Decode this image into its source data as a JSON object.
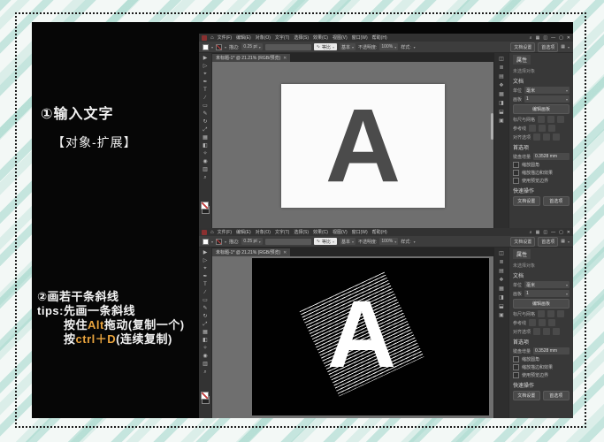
{
  "colors": {
    "stripe_teal": "#86cbbc",
    "poster_bg": "#060606",
    "highlight_orange": "#e8a33d",
    "letter_dark": "#4b4b4b",
    "letter_white": "#ffffff",
    "canvas_gray": "#6f6f6f"
  },
  "annotations": {
    "step1_title": "①输入文字",
    "step1_sub": "【对象-扩展】",
    "step2_title": "②画若干条斜线",
    "step2_tips": "tips:先画一条斜线",
    "step2_line3_pre": "按住",
    "step2_line3_key": "Alt",
    "step2_line3_post": "拖动(复制一个)",
    "step2_line4_pre": "按",
    "step2_line4_key": "ctrl＋D",
    "step2_line4_post": "(连续复制)"
  },
  "illustrator": {
    "menus": [
      "文件(F)",
      "编辑(E)",
      "对象(O)",
      "文字(T)",
      "选择(S)",
      "效果(C)",
      "视图(V)",
      "窗口(W)",
      "帮助(H)"
    ],
    "window_icons": {
      "search": "⌕",
      "arrange": "▦",
      "workspace": "◫",
      "minimize": "—",
      "maximize": "▢",
      "close": "✕"
    },
    "home_icon": "⌂",
    "doc_tab": "未标题-1* @ 21.21% (RGB/预览)",
    "tab_close": "✕",
    "controlbar": {
      "stroke_label": "描边:",
      "stroke_value": "0.25 pt",
      "profile_icon": "∿",
      "profile_value": "等比",
      "brush_value": "基本",
      "opacity_label": "不透明度:",
      "opacity_value": "100%",
      "style_label": "样式:",
      "doc_setup": "文档设置",
      "preferences": "首选项",
      "caret": "▾"
    },
    "tool_icons": [
      "▶",
      "▷",
      "⌖",
      "✒",
      "T",
      "∕",
      "▭",
      "✎",
      "↻",
      "⤢",
      "▦",
      "◧",
      "✧",
      "◉",
      "▥",
      "⌕"
    ],
    "panel_strip_icons": [
      "◫",
      "≣",
      "▤",
      "❖",
      "▦",
      "◨",
      "⬓",
      "▣"
    ],
    "properties": {
      "tab": "属性",
      "no_selection": "未选择对象",
      "document_label": "文档",
      "units_label": "单位",
      "units_value": "毫米",
      "artboard_label": "画板",
      "artboard_value": "1",
      "edit_artboards": "编辑画板",
      "rulers_label": "标尺与网格",
      "guides_label": "参考线",
      "snap_label": "对齐选项",
      "keyboard_label": "键盘增量",
      "keyboard_value": "0.3528 mm",
      "prefs_section": "首选项",
      "checkboxes": [
        "缩放圆角",
        "缩放描边和效果",
        "使用预览边界"
      ],
      "quick_label": "快速操作",
      "quick_buttons": [
        "文档设置",
        "首选项"
      ]
    },
    "canvas": {
      "top_letter": "A",
      "bottom_letter": "A"
    }
  }
}
